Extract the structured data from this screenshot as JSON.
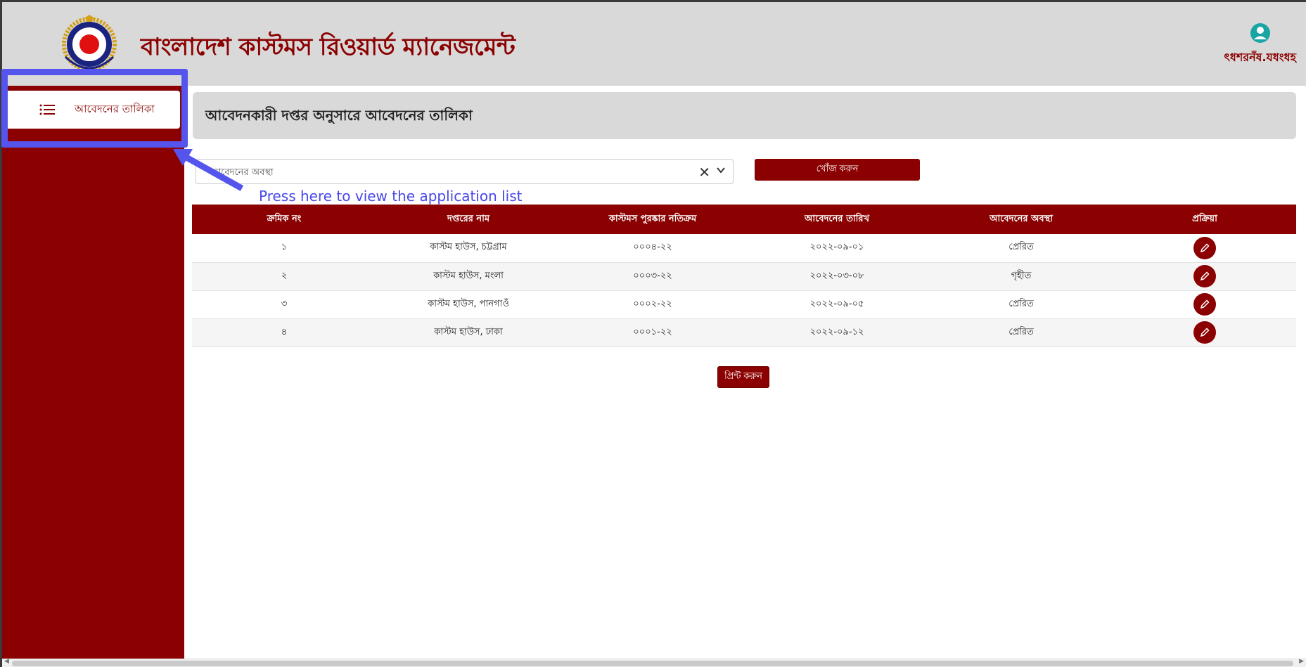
{
  "header": {
    "title": "বাংলাদেশ কাস্টমস রিওয়ার্ড ম্যানেজমেন্ট",
    "username": "ৎধশরনঁষ.যধংধহ",
    "logo_text": "BANGLADESH CUSTOMS & VAT"
  },
  "sidebar": {
    "items": [
      {
        "label": "আবেদনের তালিকা",
        "icon": "list-icon"
      }
    ]
  },
  "page": {
    "heading": "আবেদনকারী দপ্তর অনুসারে আবেদনের তালিকা"
  },
  "filter": {
    "placeholder": "আবেদনের অবস্থা",
    "search_label": "খোঁজ করুন"
  },
  "annotation": {
    "hint": "Press here to view the application list"
  },
  "table": {
    "columns": [
      "ক্রমিক নং",
      "দপ্তরের নাম",
      "কাস্টমস পুরষ্কার নতিক্রম",
      "আবেদনের তারিখ",
      "আবেদনের অবস্থা",
      "প্রক্রিয়া"
    ],
    "rows": [
      {
        "serial": "১",
        "office": "কাস্টম হাউস, চট্টগ্রাম",
        "ref": "০০০৪-২২",
        "date": "২০২২-০৯-০১",
        "status": "প্রেরিত"
      },
      {
        "serial": "২",
        "office": "কাস্টম হাউস, মংলা",
        "ref": "০০০৩-২২",
        "date": "২০২২-০৩-০৮",
        "status": "গৃহীত"
      },
      {
        "serial": "৩",
        "office": "কাস্টম হাউস, পানগাওঁ",
        "ref": "০০০২-২২",
        "date": "২০২২-০৯-০৫",
        "status": "প্রেরিত"
      },
      {
        "serial": "৪",
        "office": "কাস্টম হাউস, ঢাকা",
        "ref": "০০০১-২২",
        "date": "২০২২-০৯-১২",
        "status": "প্রেরিত"
      }
    ]
  },
  "print": {
    "label": "প্রিন্ট করুন"
  },
  "colors": {
    "brand": "#8b0000",
    "header_bg": "#d9d9d9",
    "annotation": "#4848e8"
  }
}
